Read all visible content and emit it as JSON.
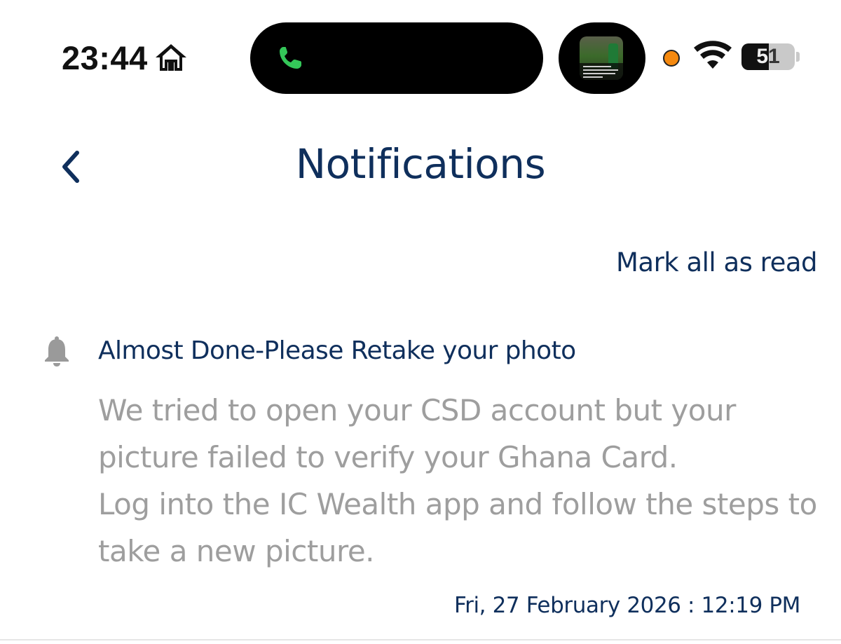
{
  "status_bar": {
    "time": "23:44",
    "battery_level": "51",
    "battery_fraction": 0.51,
    "recording_dot_color": "#f5890f",
    "call_icon_color": "#34c759"
  },
  "header": {
    "title": "Notifications",
    "back_icon": "chevron-left-icon"
  },
  "actions": {
    "mark_all_read": "Mark all as read"
  },
  "notification": {
    "icon": "bell-icon",
    "title": "Almost Done-Please Retake your photo",
    "body_lines": [
      "We tried to open your CSD account but your",
      "picture failed to verify your Ghana Card.",
      "Log into the IC Wealth app and follow the steps to",
      "take a new picture."
    ],
    "timestamp": "Fri, 27 February 2026 : 12:19 PM"
  },
  "colors": {
    "primary": "#0f2f5c",
    "body_text": "#9e9e9e",
    "icon_muted": "#9a9a9a"
  }
}
